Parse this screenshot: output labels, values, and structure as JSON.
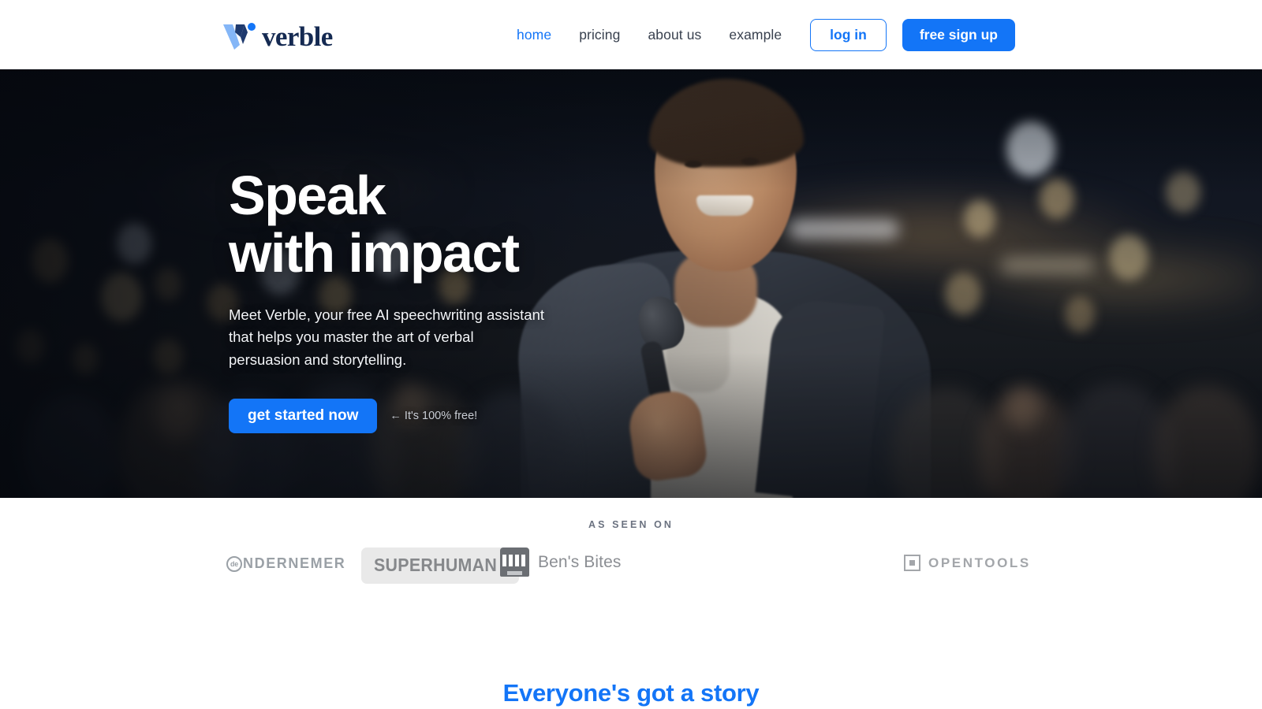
{
  "brand": {
    "name": "verble",
    "logo_icon": "verble-v-logo",
    "accent_color": "#1375f7",
    "wordmark_color": "#152a52"
  },
  "navbar": {
    "links": [
      {
        "label": "home",
        "active": true
      },
      {
        "label": "pricing",
        "active": false
      },
      {
        "label": "about us",
        "active": false
      },
      {
        "label": "example",
        "active": false
      }
    ],
    "login_label": "log in",
    "signup_label": "free sign up"
  },
  "hero": {
    "title_line1": "Speak",
    "title_line2": "with impact",
    "subtitle": "Meet Verble, your free AI speechwriting assistant that helps you master the art of verbal persuasion and storytelling.",
    "cta_label": "get started now",
    "cta_note": "← It's 100% free!",
    "image_alt": "Smiling man in a dark suit holding a microphone, speaking to a blurred audience with warm bokeh lights"
  },
  "as_seen_on": {
    "label": "AS SEEN ON",
    "logos": [
      {
        "name": "de ONDERNEMER",
        "badge_text": "de",
        "word": "NDERNEMER",
        "icon": "circle-de-icon"
      },
      {
        "name": "SUPERHUMAN",
        "word": "SUPERHUMAN",
        "icon": "none"
      },
      {
        "name": "Ben's Bites",
        "word": "Ben's Bites",
        "icon": "building-grid-icon"
      },
      {
        "name": "OPENTOOLS",
        "word": "OPENTOOLS",
        "icon": "square-dot-icon"
      }
    ]
  },
  "next_section": {
    "heading": "Everyone's got a story"
  }
}
